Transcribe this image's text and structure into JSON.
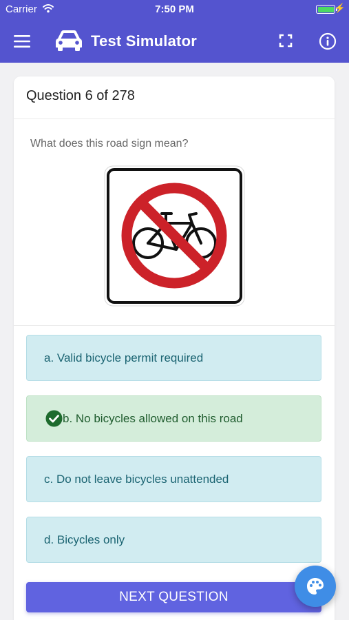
{
  "status_bar": {
    "carrier": "Carrier",
    "time": "7:50 PM",
    "wifi_icon": "wifi-icon",
    "battery_icon": "battery-icon",
    "battery_level": 1.0,
    "charging_icon": "bolt-icon"
  },
  "header": {
    "title": "Test Simulator",
    "menu_icon": "hamburger-menu-icon",
    "logo_icon": "car-icon",
    "fullscreen_icon": "fullscreen-icon",
    "info_icon": "info-icon",
    "background_color": "#5454cf"
  },
  "question": {
    "counter": "Question 6 of 278",
    "text": "What does this road sign mean?",
    "image_icon": "no-bicycles-road-sign",
    "answers": [
      {
        "label": "a. Valid bicycle permit required",
        "state": "neutral"
      },
      {
        "label": "b. No bicycles allowed on this road",
        "state": "correct"
      },
      {
        "label": "c. Do not leave bicycles unattended",
        "state": "neutral"
      },
      {
        "label": "d. Bicycles only",
        "state": "neutral"
      }
    ]
  },
  "actions": {
    "next_label": "NEXT QUESTION",
    "theme_icon": "palette-icon"
  },
  "colors": {
    "neutral_answer": "#d1ecf1",
    "correct_answer": "#d4edda",
    "correct_check": "#1e6b2e",
    "next_button": "#6063e0",
    "fab": "#3f8de6",
    "sign_red": "#cc2229"
  }
}
